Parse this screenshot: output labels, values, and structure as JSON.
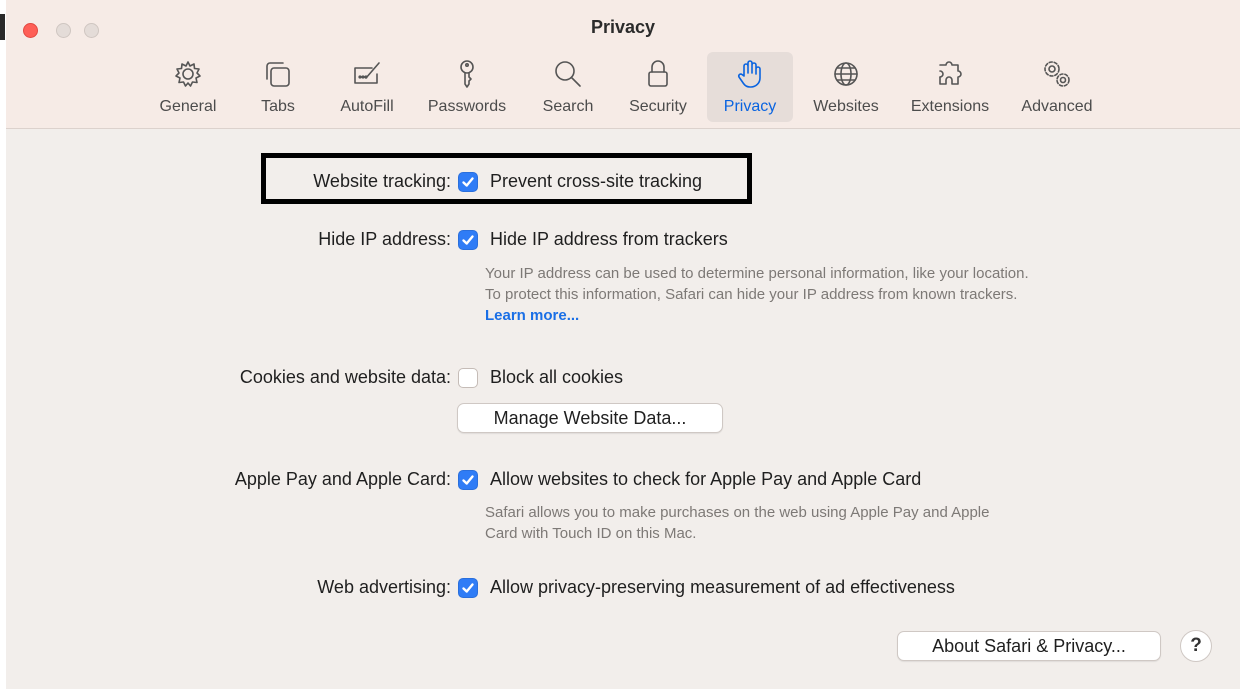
{
  "window": {
    "title": "Privacy"
  },
  "toolbar": {
    "items": [
      {
        "label": "General",
        "icon": "gear-icon"
      },
      {
        "label": "Tabs",
        "icon": "tabs-icon"
      },
      {
        "label": "AutoFill",
        "icon": "autofill-icon"
      },
      {
        "label": "Passwords",
        "icon": "key-icon"
      },
      {
        "label": "Search",
        "icon": "magnifier-icon"
      },
      {
        "label": "Security",
        "icon": "lock-icon"
      },
      {
        "label": "Privacy",
        "icon": "hand-icon"
      },
      {
        "label": "Websites",
        "icon": "globe-icon"
      },
      {
        "label": "Extensions",
        "icon": "puzzle-icon"
      },
      {
        "label": "Advanced",
        "icon": "gears-icon"
      }
    ],
    "active": "Privacy"
  },
  "settings": {
    "website_tracking": {
      "label": "Website tracking:",
      "option": "Prevent cross-site tracking",
      "checked": true
    },
    "hide_ip": {
      "label": "Hide IP address:",
      "option": "Hide IP address from trackers",
      "checked": true,
      "description": "Your IP address can be used to determine personal information, like your location. To protect this information, Safari can hide your IP address from known trackers.",
      "link": "Learn more..."
    },
    "cookies": {
      "label": "Cookies and website data:",
      "option": "Block all cookies",
      "checked": false,
      "button": "Manage Website Data..."
    },
    "apple_pay": {
      "label": "Apple Pay and Apple Card:",
      "option": "Allow websites to check for Apple Pay and Apple Card",
      "checked": true,
      "description": "Safari allows you to make purchases on the web using Apple Pay and Apple Card with Touch ID on this Mac."
    },
    "web_advertising": {
      "label": "Web advertising:",
      "option": "Allow privacy-preserving measurement of ad effectiveness",
      "checked": true
    }
  },
  "footer": {
    "about_button": "About Safari & Privacy...",
    "help_button": "?"
  },
  "colors": {
    "accent": "#2f7cf6",
    "link": "#1a6fe6",
    "close": "#fe5f57",
    "highlight_border": "#000000"
  }
}
